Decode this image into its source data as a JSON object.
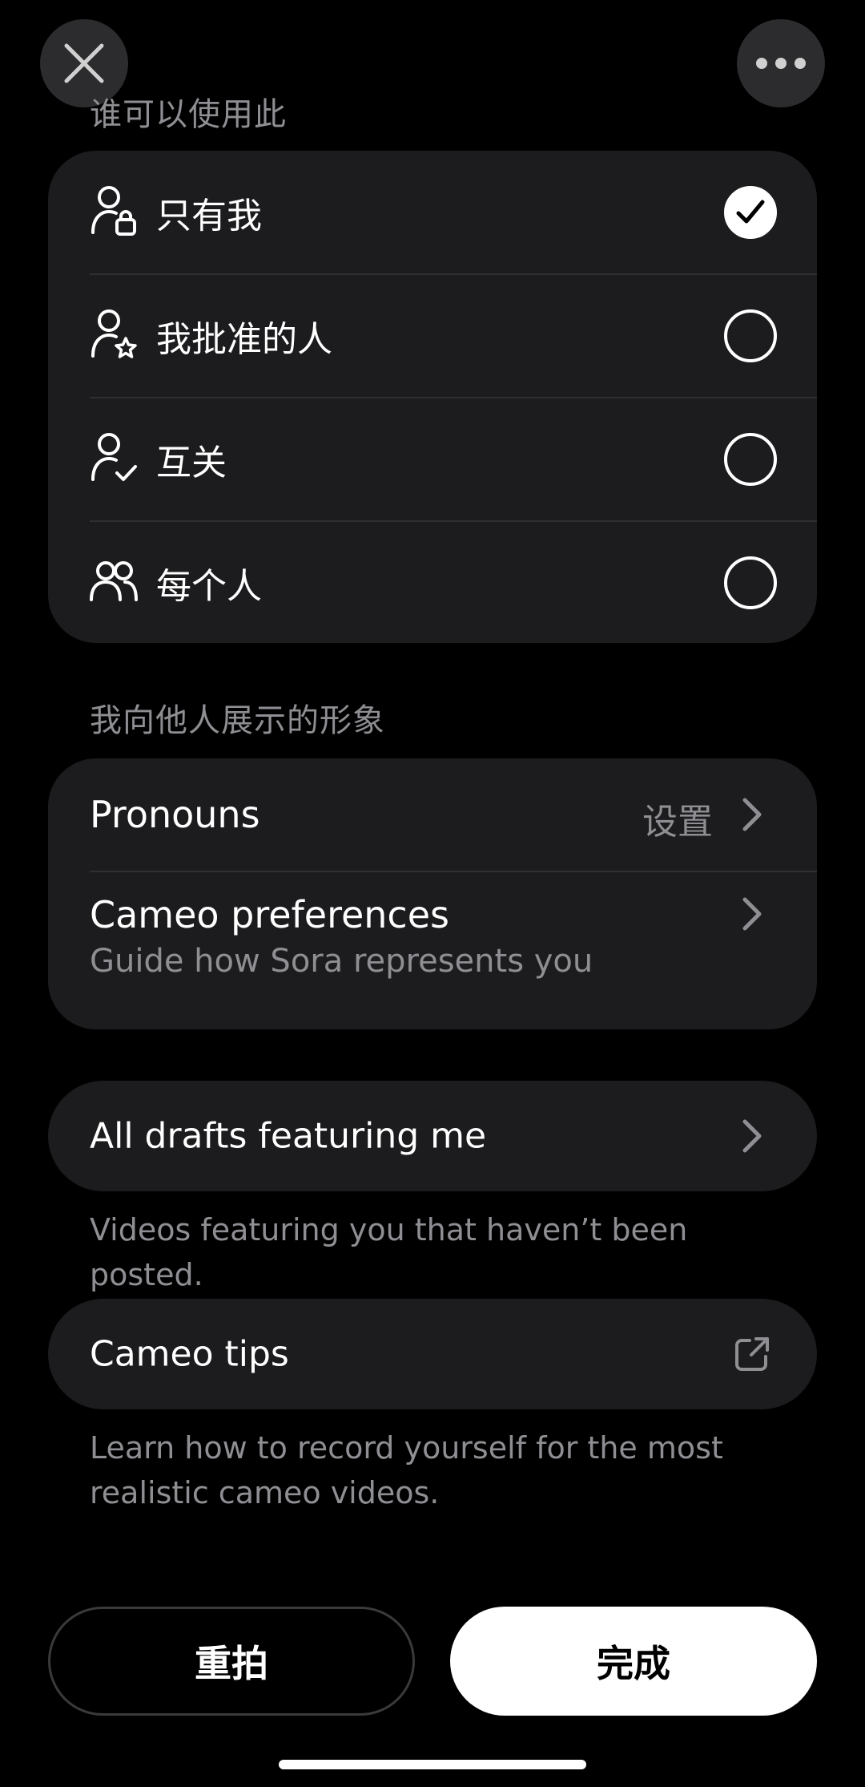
{
  "header": {
    "close_icon": "close-icon",
    "more_icon": "more-icon"
  },
  "audience": {
    "section_title": "谁可以使用此",
    "options": [
      {
        "label": "只有我",
        "icon": "person-lock-icon",
        "selected": true
      },
      {
        "label": "我批准的人",
        "icon": "person-star-icon",
        "selected": false
      },
      {
        "label": "互关",
        "icon": "person-check-icon",
        "selected": false
      },
      {
        "label": "每个人",
        "icon": "people-icon",
        "selected": false
      }
    ]
  },
  "appearance": {
    "section_title": "我向他人展示的形象",
    "pronouns": {
      "label": "Pronouns",
      "value": "设置"
    },
    "cameo_preferences": {
      "label": "Cameo preferences",
      "subtitle": "Guide how Sora represents you"
    }
  },
  "drafts": {
    "label": "All drafts featuring me",
    "helper": "Videos featuring you that haven’t been posted."
  },
  "tips": {
    "label": "Cameo tips",
    "icon": "external-link-icon",
    "helper": "Learn how to record yourself for the most realistic cameo videos."
  },
  "actions": {
    "retake": "重拍",
    "done": "完成"
  }
}
